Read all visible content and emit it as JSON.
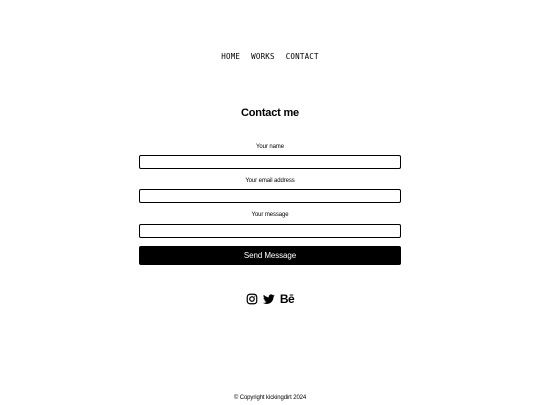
{
  "nav": {
    "home": "HOME",
    "works": "WORKS",
    "contact": "CONTACT"
  },
  "contact": {
    "title": "Contact me",
    "name_label": "Your name",
    "email_label": "Your email address",
    "message_label": "Your message",
    "name_value": "",
    "email_value": "",
    "message_value": "",
    "send_label": "Send Message"
  },
  "socials": {
    "instagram_icon": "instagram-icon",
    "twitter_icon": "twitter-icon",
    "behance_icon": "behance-icon",
    "behance_text": "Bē"
  },
  "footer": {
    "copyright": "© Copyright kickingdirt 2024"
  },
  "colors": {
    "background": "#ffffff",
    "text": "#000000",
    "button_bg": "#000000",
    "button_text": "#ffffff"
  }
}
